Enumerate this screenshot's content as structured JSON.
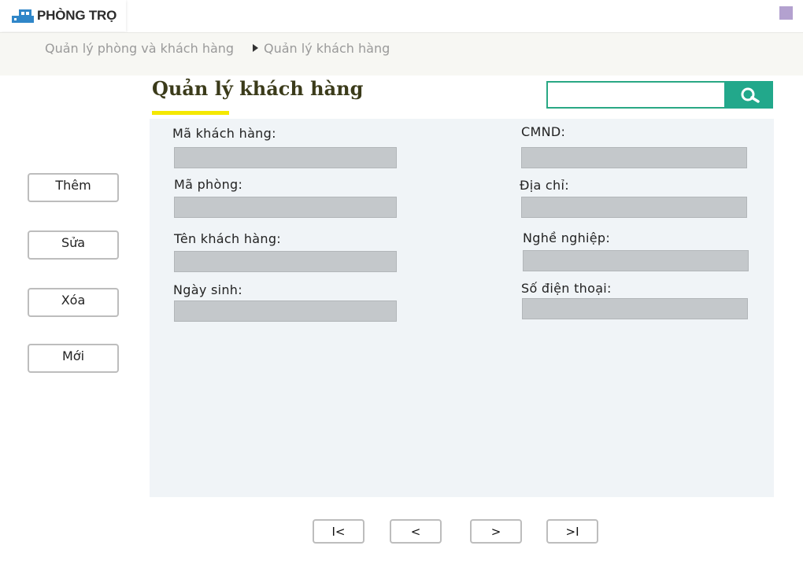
{
  "header": {
    "logo_text": "PHÒNG TRỌ",
    "logo_color": "#2f86c8",
    "accent_square_color": "#b3a1cf"
  },
  "breadcrumb": {
    "items": [
      "Quản lý phòng và khách hàng",
      "Quản lý khách hàng"
    ]
  },
  "page": {
    "title": "Quản lý khách hàng",
    "title_underline_color": "#f4e800"
  },
  "search": {
    "value": "",
    "placeholder": "",
    "button_icon": "search-icon",
    "button_color": "#22a88b"
  },
  "form": {
    "left_fields": [
      {
        "label": "Mã khách hàng:",
        "value": ""
      },
      {
        "label": "Mã phòng:",
        "value": ""
      },
      {
        "label": "Tên khách hàng:",
        "value": ""
      },
      {
        "label": "Ngày sinh:",
        "value": ""
      }
    ],
    "right_fields": [
      {
        "label": "CMND:",
        "value": ""
      },
      {
        "label": "Địa chỉ:",
        "value": ""
      },
      {
        "label": "Nghề nghiệp:",
        "value": ""
      },
      {
        "label": "Số điện thoại:",
        "value": ""
      }
    ]
  },
  "actions": {
    "add": "Thêm",
    "edit": "Sửa",
    "delete": "Xóa",
    "new": "Mới"
  },
  "pagination": {
    "first": "I<",
    "prev": "<",
    "next": ">",
    "last": ">I"
  }
}
